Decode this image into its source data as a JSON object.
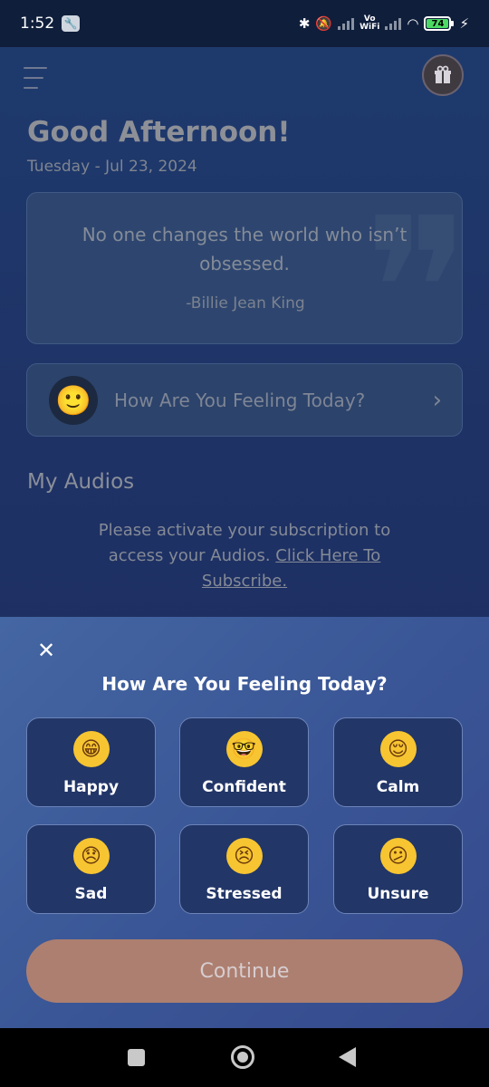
{
  "status_bar": {
    "time": "1:52",
    "battery": "74",
    "vowifi_top": "Vo",
    "vowifi_bottom": "WiFi"
  },
  "header": {
    "menu_icon": "hamburger-menu-icon",
    "gift_icon": "gift-icon"
  },
  "greeting": {
    "title": "Good Afternoon!",
    "date": "Tuesday - Jul 23, 2024"
  },
  "quote": {
    "text": "No one changes the world who isn’t obsessed.",
    "author": "-Billie Jean King"
  },
  "feeling_card": {
    "label": "How Are You Feeling Today?",
    "emoji": "🙂",
    "chevron": "›"
  },
  "audios": {
    "title": "My Audios",
    "message": "Please activate your subscription to access your Audios.",
    "link": "Click Here To Subscribe."
  },
  "sheet": {
    "close": "✕",
    "title": "How Are You Feeling Today?",
    "moods": [
      {
        "label": "Happy",
        "emoji": "😁"
      },
      {
        "label": "Confident",
        "emoji": "🤓"
      },
      {
        "label": "Calm",
        "emoji": "😌"
      },
      {
        "label": "Sad",
        "emoji": "😞"
      },
      {
        "label": "Stressed",
        "emoji": "😣"
      },
      {
        "label": "Unsure",
        "emoji": "😕"
      }
    ],
    "continue": "Continue"
  },
  "colors": {
    "sheet_bg": "#3a5696",
    "tile_bg": "#223668",
    "continue_bg": "#ad7f70",
    "emoji_yellow": "#f7c531"
  }
}
